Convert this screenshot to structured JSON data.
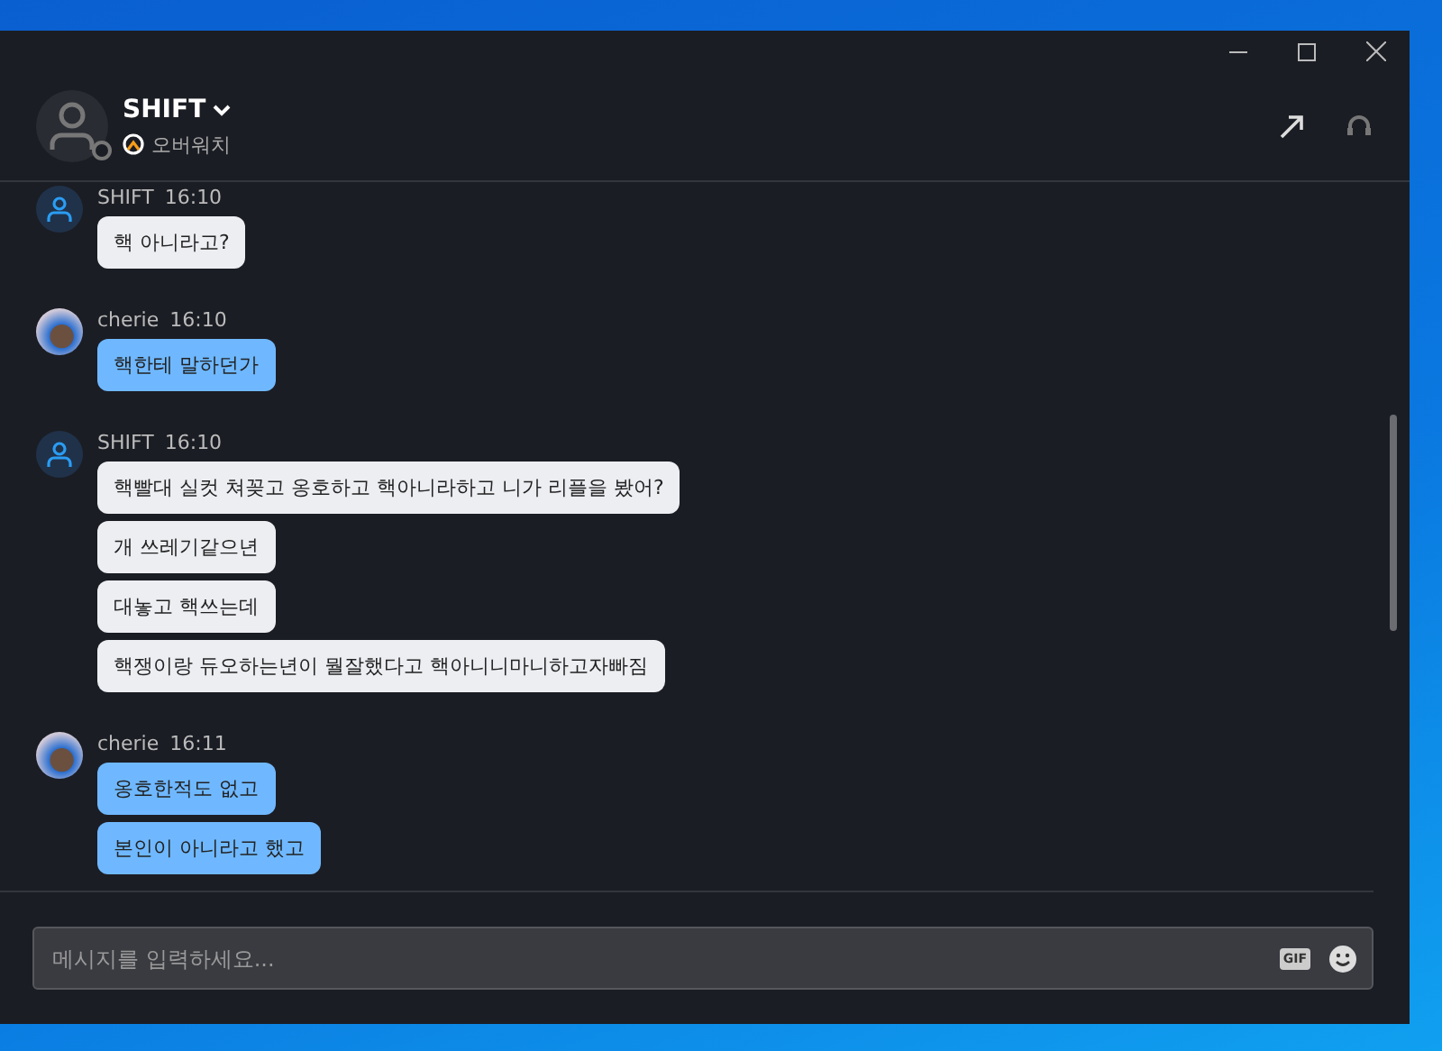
{
  "header": {
    "name": "SHIFT",
    "game": "오버워치",
    "online": false
  },
  "messages": [
    {
      "author": "SHIFT",
      "time": "16:10",
      "kind": "other",
      "lines": [
        "핵 아니라고?"
      ]
    },
    {
      "author": "cherie",
      "time": "16:10",
      "kind": "self",
      "lines": [
        "핵한테 말하던가"
      ]
    },
    {
      "author": "SHIFT",
      "time": "16:10",
      "kind": "other",
      "lines": [
        "핵빨대 실컷 쳐꽂고 옹호하고 핵아니라하고 니가 리플을 봤어?",
        "개 쓰레기같으년",
        "대놓고 핵쓰는데",
        "핵쟁이랑 듀오하는년이 뭘잘했다고 핵아니니마니하고자빠짐"
      ]
    },
    {
      "author": "cherie",
      "time": "16:11",
      "kind": "self",
      "lines": [
        "옹호한적도 없고",
        "본인이 아니라고 했고"
      ]
    }
  ],
  "input": {
    "placeholder": "메시지를 입력하세요...",
    "gif_button": "GIF"
  }
}
